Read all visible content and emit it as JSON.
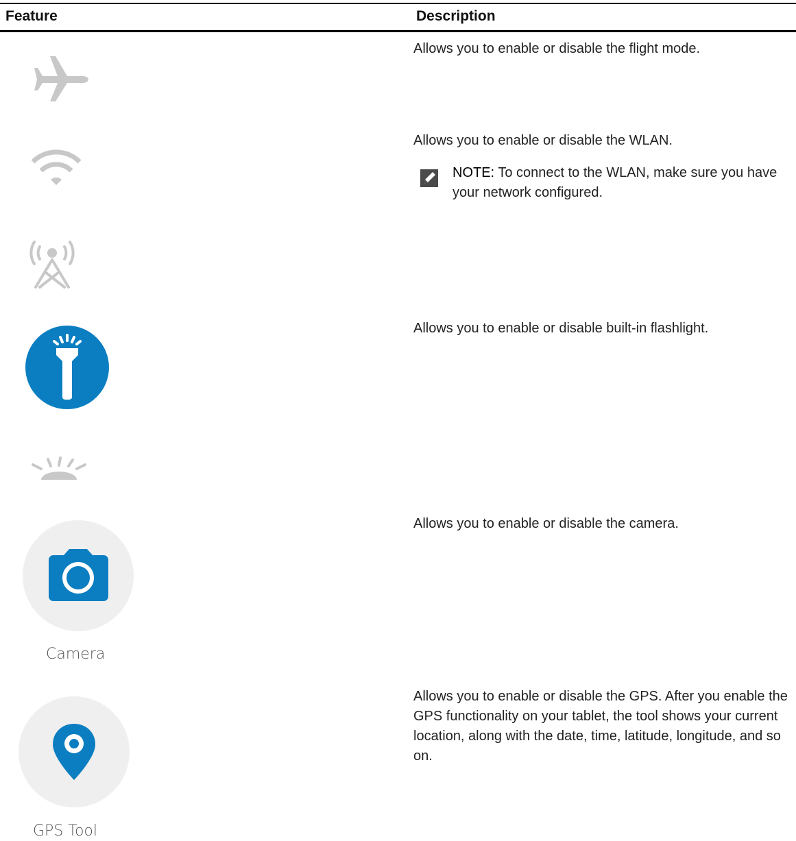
{
  "table": {
    "headers": {
      "feature": "Feature",
      "description": "Description"
    },
    "rows": [
      {
        "icon": "airplane-icon",
        "description": "Allows you to enable or disable the flight mode."
      },
      {
        "icon": "wifi-icon",
        "description": "Allows you to enable or disable the WLAN.",
        "note_label": "NOTE:",
        "note_text": " To connect to the WLAN, make sure you have your network configured."
      },
      {
        "icon": "cellular-tower-icon",
        "description": ""
      },
      {
        "icon": "flashlight-icon",
        "description": "Allows you to enable or disable built-in flashlight."
      },
      {
        "icon": "brightness-icon",
        "description": ""
      },
      {
        "icon": "camera-icon",
        "caption": "Camera",
        "description": "Allows you to enable or disable the camera."
      },
      {
        "icon": "location-pin-icon",
        "caption": "GPS Tool",
        "description": "Allows you to enable or disable the GPS. After you enable the GPS functionality on your tablet, the tool shows your current location, along with the date, time, latitude, longitude, and so on."
      }
    ]
  },
  "colors": {
    "accent_blue": "#0b7ec1",
    "icon_gray": "#c8c8c8",
    "tile_gray": "#efefef",
    "rule": "#000000"
  }
}
